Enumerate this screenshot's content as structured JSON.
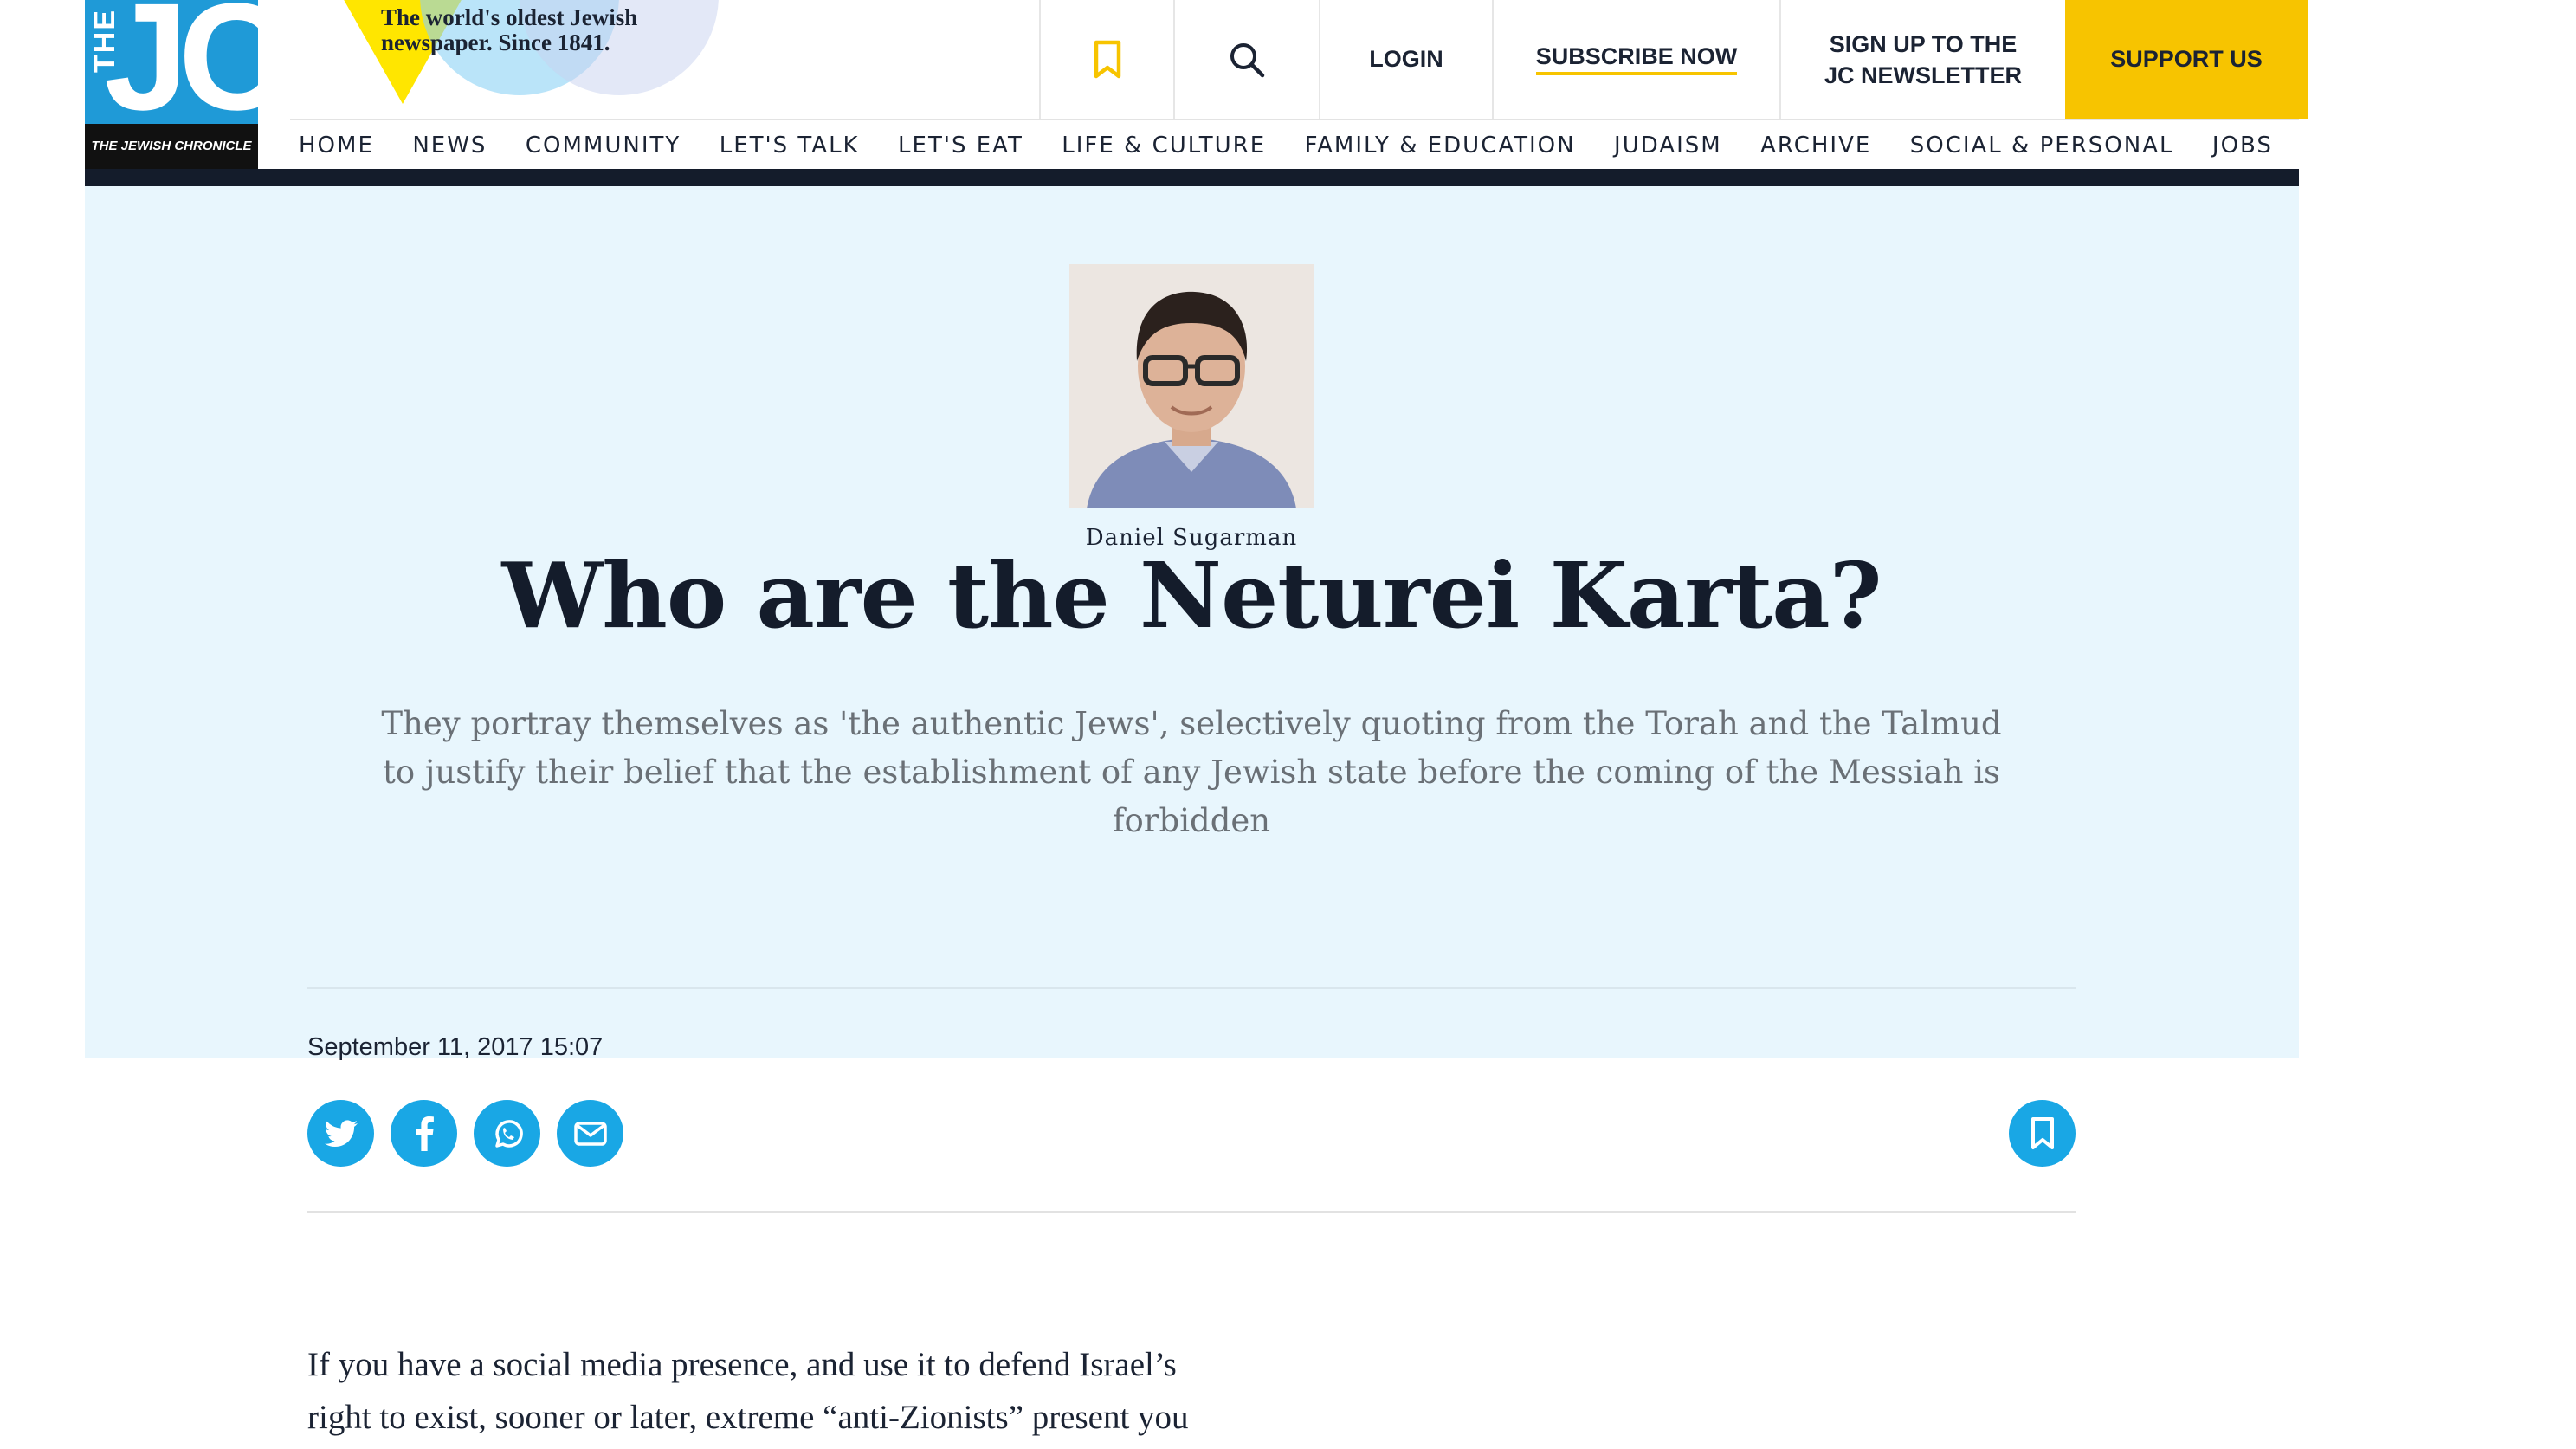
{
  "logo": {
    "the": "THE",
    "jc": "JC",
    "band": "THE JEWISH CHRONICLE"
  },
  "tagline": {
    "line1": "The world's oldest Jewish",
    "line2": "newspaper. Since 1841."
  },
  "header": {
    "login": "LOGIN",
    "subscribe": "SUBSCRIBE NOW",
    "newsletter_line1": "SIGN UP TO THE",
    "newsletter_line2": "JC NEWSLETTER",
    "support": "SUPPORT US"
  },
  "nav": {
    "items": [
      {
        "label": "HOME"
      },
      {
        "label": "NEWS"
      },
      {
        "label": "COMMUNITY"
      },
      {
        "label": "LET'S TALK"
      },
      {
        "label": "LET'S EAT"
      },
      {
        "label": "LIFE & CULTURE"
      },
      {
        "label": "FAMILY & EDUCATION"
      },
      {
        "label": "JUDAISM"
      },
      {
        "label": "ARCHIVE"
      },
      {
        "label": "SOCIAL & PERSONAL"
      },
      {
        "label": "JOBS"
      }
    ]
  },
  "article": {
    "author": "Daniel Sugarman",
    "title": "Who are the Neturei Karta?",
    "standfirst": "They portray themselves as 'the authentic Jews', selectively quoting from the Torah and the Talmud to justify their belief that the establishment of any Jewish state before the coming of the Messiah is forbidden",
    "date": "September 11, 2017 15:07",
    "body_line1": "If you have a social media presence, and use it to defend Israel’s",
    "body_line2": "right to exist, sooner or later, extreme “anti-Zionists” present you"
  },
  "icons": {
    "bookmark": "bookmark-icon",
    "search": "search-icon",
    "twitter": "twitter-icon",
    "facebook": "facebook-icon",
    "whatsapp": "whatsapp-icon",
    "email": "email-icon"
  },
  "colors": {
    "brand_blue": "#1f9ad7",
    "support_yellow": "#f7c400",
    "hero_bg": "#e8f6fd",
    "share_blue": "#19a7e5",
    "nav_dark": "#141c2b"
  }
}
